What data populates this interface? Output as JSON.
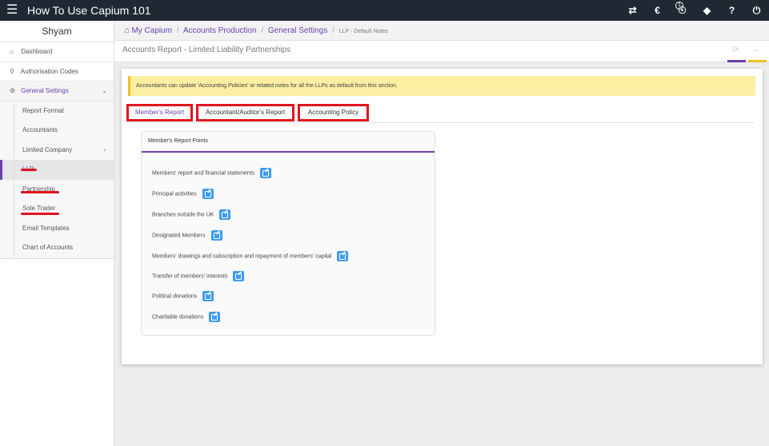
{
  "app": {
    "title": "How To Use Capium 101"
  },
  "topbar": {
    "icons": [
      "hamburger-icon",
      "transfer-icon",
      "currency-icon",
      "notifications-icon",
      "ticket-icon",
      "help-icon",
      "power-icon"
    ],
    "help_glyph": "?",
    "notification_count": "1"
  },
  "sidebar": {
    "user": "Shyam",
    "items": [
      {
        "label": "Dashboard",
        "icon": "home-icon"
      },
      {
        "label": "Authorisation Codes",
        "icon": "key-icon"
      },
      {
        "label": "General Settings",
        "icon": "cogs-icon"
      }
    ],
    "sub_items": [
      {
        "label": "Report Format"
      },
      {
        "label": "Accountants"
      },
      {
        "label": "Limited Company"
      },
      {
        "label": "LLP"
      },
      {
        "label": "Partnership"
      },
      {
        "label": "Sole Trader"
      },
      {
        "label": "Email Templates"
      },
      {
        "label": "Chart of Accounts"
      }
    ]
  },
  "breadcrumb": {
    "items": [
      "My Capium",
      "Accounts Production",
      "General Settings"
    ],
    "current": "LLP - Default Notes"
  },
  "page": {
    "title": "Accounts Report - Limited Liability Partnerships",
    "accent_purple": "#6a3fb0",
    "accent_yellow": "#f0c020"
  },
  "notice": {
    "text": "Accountants can update 'Accounting Policies' or related notes for all the LLPs as default from this section."
  },
  "tabs": [
    {
      "label": "Member's Report",
      "active": true
    },
    {
      "label": "Accountant/Auditor's Report",
      "active": false
    },
    {
      "label": "Accounting Policy",
      "active": false
    }
  ],
  "card": {
    "title": "Member's Report Points",
    "points": [
      "Members' report and financial statements",
      "Principal activities",
      "Branches outside the UK",
      "Designated Members",
      "Members' drawings and subscription and repayment of members' capital",
      "Transfer of members' interests",
      "Political donations",
      "Charitable donations"
    ]
  },
  "colors": {
    "topbar": "#1e2933",
    "highlight_red": "#e0141c",
    "notice_bg": "#fcefa2",
    "edit_button": "#3c9cf0"
  }
}
